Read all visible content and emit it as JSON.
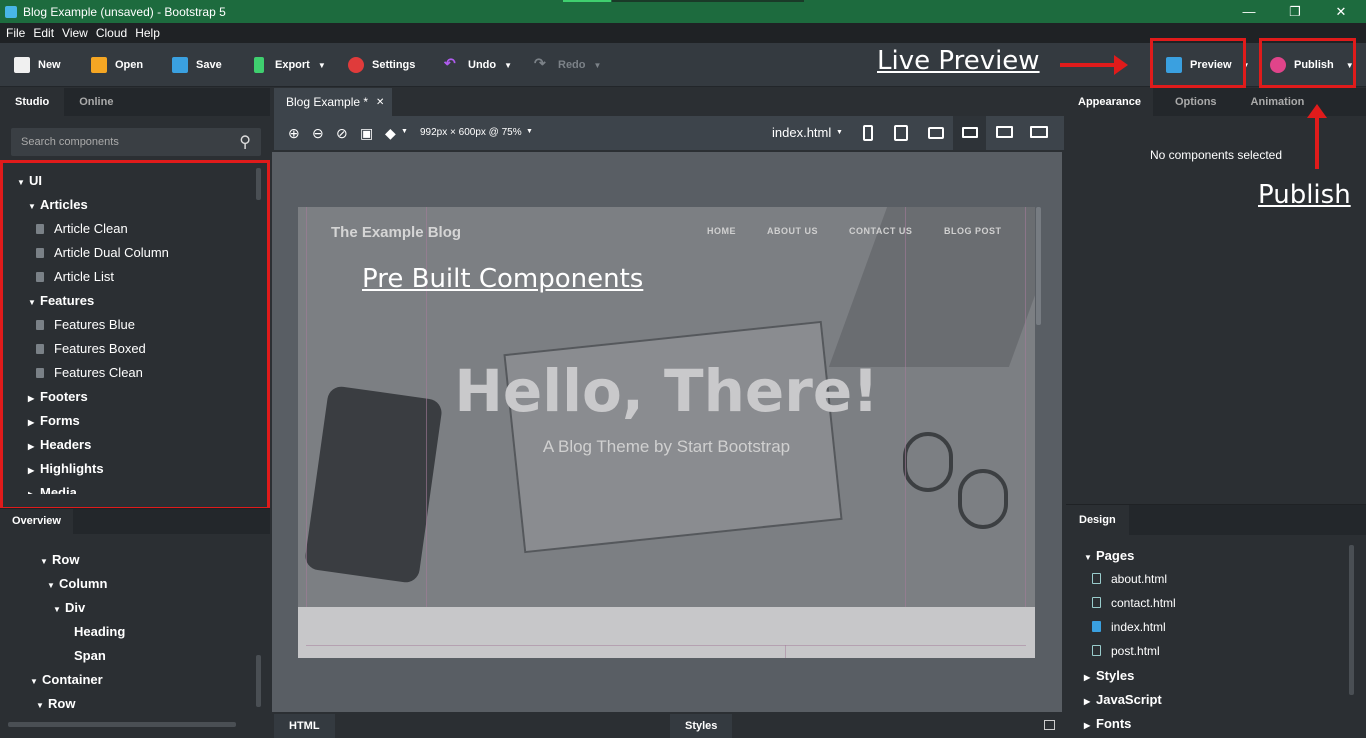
{
  "window": {
    "title": "Blog Example (unsaved) - Bootstrap 5"
  },
  "menu": [
    "File",
    "Edit",
    "View",
    "Cloud",
    "Help"
  ],
  "toolbar": {
    "new": "New",
    "open": "Open",
    "save": "Save",
    "export": "Export",
    "settings": "Settings",
    "undo": "Undo",
    "redo": "Redo",
    "preview": "Preview",
    "publish": "Publish"
  },
  "annotations": {
    "live_preview": "Live Preview",
    "publish": "Publish",
    "prebuilt": "Pre Built Components"
  },
  "left_panel": {
    "tabs": [
      "Studio",
      "Online"
    ],
    "search_placeholder": "Search components",
    "tree": [
      {
        "label": "UI"
      },
      {
        "label": "Articles"
      },
      {
        "label": "Article Clean"
      },
      {
        "label": "Article Dual Column"
      },
      {
        "label": "Article List"
      },
      {
        "label": "Features"
      },
      {
        "label": "Features Blue"
      },
      {
        "label": "Features Boxed"
      },
      {
        "label": "Features Clean"
      },
      {
        "label": "Footers"
      },
      {
        "label": "Forms"
      },
      {
        "label": "Headers"
      },
      {
        "label": "Highlights"
      },
      {
        "label": "Media"
      }
    ]
  },
  "overview": {
    "tab": "Overview",
    "tree": [
      "Row",
      "Column",
      "Div",
      "Heading",
      "Span",
      "Container",
      "Row"
    ]
  },
  "editor": {
    "tab": "Blog Example *",
    "size_readout": "992px × 600px @ 75%",
    "file_select": "index.html",
    "bottom_tabs": [
      "HTML",
      "Styles"
    ]
  },
  "preview": {
    "blog_title": "The Example Blog",
    "nav": [
      "HOME",
      "ABOUT US",
      "CONTACT US",
      "BLOG POST"
    ],
    "heading": "Hello, There!",
    "subheading": "A Blog Theme by Start Bootstrap"
  },
  "right_panel": {
    "tabs": [
      "Appearance",
      "Options",
      "Animation"
    ],
    "empty_message": "No components selected"
  },
  "design": {
    "tab": "Design",
    "tree": [
      "Pages",
      "about.html",
      "contact.html",
      "index.html",
      "post.html",
      "Styles",
      "JavaScript",
      "Fonts"
    ]
  },
  "colors": {
    "accent": "#e01b1b",
    "titlebar": "#1d6b3e"
  }
}
